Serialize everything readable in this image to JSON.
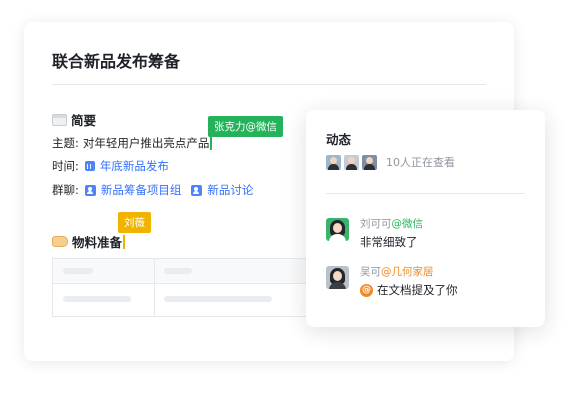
{
  "document": {
    "title": "联合新品发布筹备",
    "section1": {
      "heading": "简要",
      "theme_label": "主题:",
      "theme_value": "对年轻用户推出亮点产品",
      "time_label": "时间:",
      "time_link": "年底新品发布",
      "group_label": "群聊:",
      "group_links": [
        "新品筹备项目组",
        "新品讨论"
      ]
    },
    "section2": {
      "heading": "物料准备"
    },
    "cursors": {
      "green_tag": "张克力@微信",
      "yellow_tag": "刘薇"
    }
  },
  "activity": {
    "title": "动态",
    "viewers_text": "10人正在查看",
    "comments": [
      {
        "name": "刘可可",
        "source": "@微信",
        "text": "非常细致了"
      },
      {
        "name": "吴可",
        "source": "@几何家居",
        "text": "在文档提及了你",
        "icon": "@"
      }
    ]
  },
  "colors": {
    "link": "#3370ff",
    "green_tag": "#24b35a",
    "yellow_tag": "#f0b400",
    "mention_orange": "#f08a24"
  },
  "icons": [
    "note-emoji-icon",
    "calendar-icon",
    "group-chat-icon",
    "hand-emoji-icon",
    "mention-icon"
  ]
}
